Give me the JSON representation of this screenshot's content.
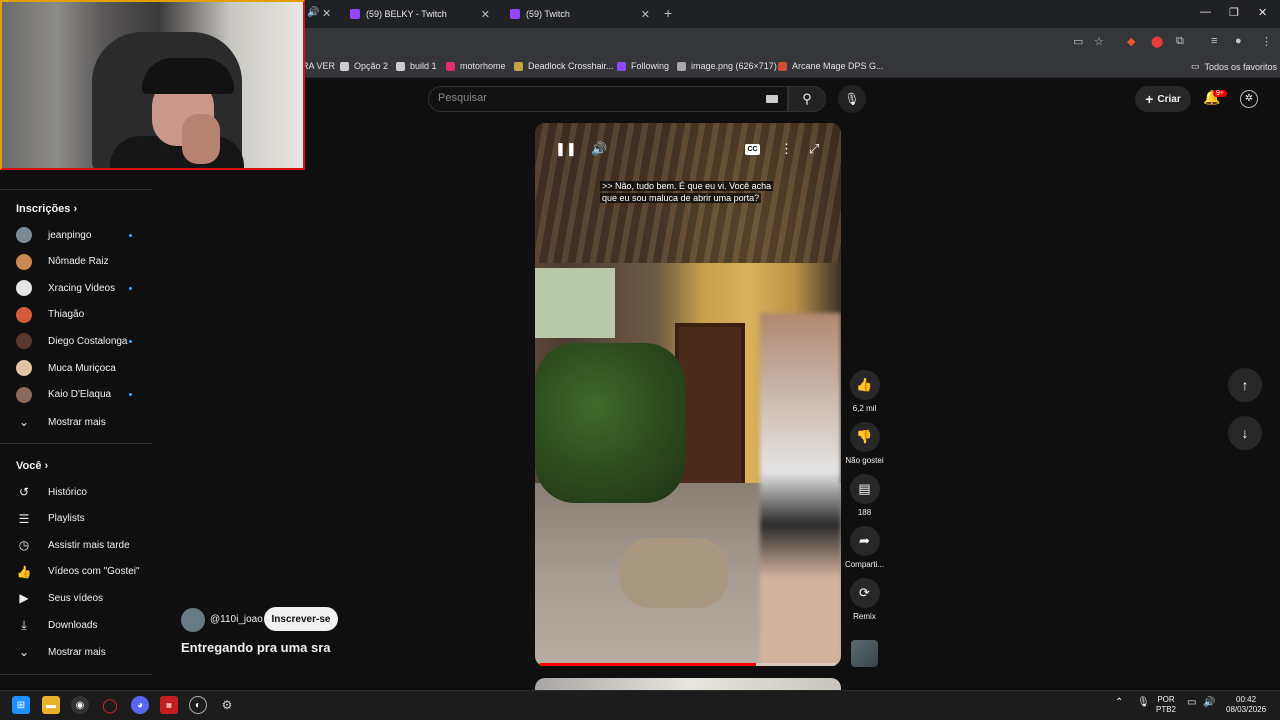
{
  "browser": {
    "tabs": [
      {
        "title": "(59) BELKY - Twitch"
      },
      {
        "title": "(59) Twitch"
      }
    ],
    "bookmarks": [
      {
        "label": "RA VER",
        "color": "#888888"
      },
      {
        "label": "Opção 2",
        "color": "#cccccc"
      },
      {
        "label": "build 1",
        "color": "#cccccc"
      },
      {
        "label": "motorhome",
        "color": "#e1306c"
      },
      {
        "label": "Deadlock Crosshair...",
        "color": "#c8a24a"
      },
      {
        "label": "Following",
        "color": "#9146ff"
      },
      {
        "label": "image.png (626×717)",
        "color": "#aaaaaa"
      },
      {
        "label": "Arcane Mage DPS G...",
        "color": "#d44b3a"
      }
    ],
    "all_bookmarks": "Todos os favoritos"
  },
  "youtube": {
    "search": {
      "placeholder": "Pesquisar"
    },
    "create_label": "Criar",
    "notifications_badge": "9+"
  },
  "sidebar": {
    "subscriptions_title": "Inscrições",
    "subscriptions": [
      {
        "name": "jeanpingo",
        "new": true,
        "color": "#7a8a96"
      },
      {
        "name": "Nômade Raiz",
        "new": false,
        "color": "#c98a54"
      },
      {
        "name": "Xracing Videos",
        "new": true,
        "color": "#e5e5e5"
      },
      {
        "name": "Thiagão",
        "new": false,
        "color": "#d45a3c"
      },
      {
        "name": "Diego Costalonga",
        "new": true,
        "color": "#5a3a2e"
      },
      {
        "name": "Muca Muriçoca",
        "new": false,
        "color": "#e2c3a5"
      },
      {
        "name": "Kaio D'Elaqua",
        "new": true,
        "color": "#8a6a5a"
      }
    ],
    "show_more_subs": "Mostrar mais",
    "you_title": "Você",
    "you_items": [
      {
        "label": "Histórico",
        "icon": "history-icon"
      },
      {
        "label": "Playlists",
        "icon": "playlists-icon"
      },
      {
        "label": "Assistir mais tarde",
        "icon": "watch-later-icon"
      },
      {
        "label": "Vídeos com \"Gostei\"",
        "icon": "liked-icon"
      },
      {
        "label": "Seus vídeos",
        "icon": "your-videos-icon"
      },
      {
        "label": "Downloads",
        "icon": "downloads-icon"
      }
    ],
    "show_more_you": "Mostrar mais"
  },
  "short": {
    "caption_line1": ">> Não, tudo bem. É que eu vi. Você acha",
    "caption_line2": "que eu sou maluca de abrir uma porta?",
    "cc_label": "CC",
    "progress": 0.73,
    "likes": "6,2 mil",
    "dislike_label": "Não gostei",
    "comments": "188",
    "share_label": "Comparti...",
    "remix_label": "Remix",
    "channel": "@110i_joao",
    "subscribe_label": "Inscrever-se",
    "title": "Entregando pra uma sra"
  },
  "taskbar": {
    "lang_top": "POR",
    "lang_bottom": "PTB2",
    "time": "00:42",
    "date": "08/03/2026"
  }
}
